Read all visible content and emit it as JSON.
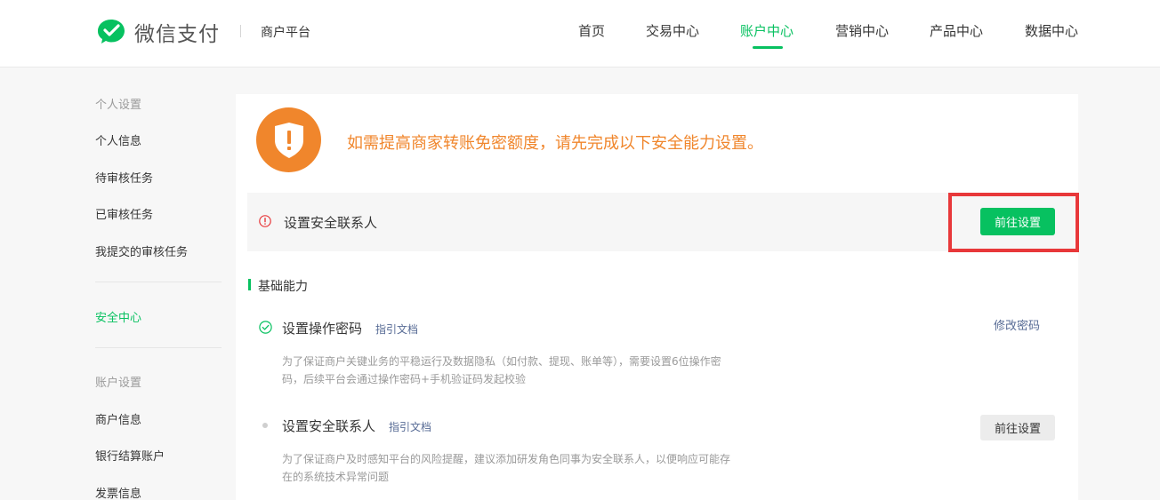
{
  "header": {
    "logo_text": "微信支付",
    "platform_label": "商户平台",
    "nav": [
      "首页",
      "交易中心",
      "账户中心",
      "营销中心",
      "产品中心",
      "数据中心"
    ],
    "active_nav": "账户中心"
  },
  "sidebar": {
    "group_personal": "个人设置",
    "personal_items": [
      "个人信息",
      "待审核任务",
      "已审核任务",
      "我提交的审核任务"
    ],
    "security_center": "安全中心",
    "group_account": "账户设置",
    "account_items": [
      "商户信息",
      "银行结算账户",
      "发票信息"
    ]
  },
  "alert": {
    "text": "如需提高商家转账免密额度，请先完成以下安全能力设置。"
  },
  "pending": {
    "label": "设置安全联系人",
    "button": "前往设置"
  },
  "section": {
    "title": "基础能力"
  },
  "items": [
    {
      "title": "设置操作密码",
      "guide": "指引文档",
      "action": "修改密码",
      "desc_line1": "为了保证商户关键业务的平稳运行及数据隐私（如付款、提现、账单等），需要设置6位操作密",
      "desc_line2": "码，后续平台会通过操作密码+手机验证码发起校验"
    },
    {
      "title": "设置安全联系人",
      "guide": "指引文档",
      "action": "前往设置",
      "desc_line1": "为了保证商户及时感知平台的风险提醒，建议添加研发角色同事为安全联系人，以便响应可能存",
      "desc_line2": "在的系统技术异常问题"
    }
  ],
  "colors": {
    "brand_green": "#07c160",
    "warning_orange": "#f0862c",
    "link_blue": "#576b95",
    "highlight_red": "#e8383a"
  }
}
